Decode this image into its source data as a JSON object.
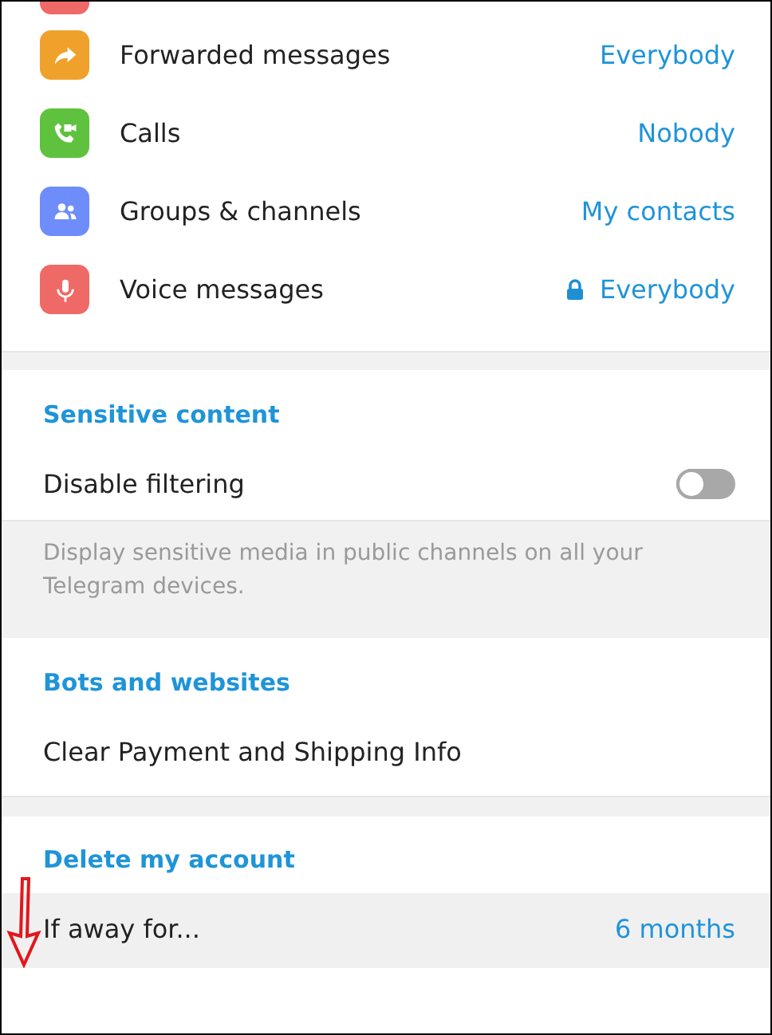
{
  "privacy_rows": [
    {
      "kind": "forward",
      "label": "Forwarded messages",
      "value": "Everybody",
      "locked": false,
      "color": "#f0a12b"
    },
    {
      "kind": "calls",
      "label": "Calls",
      "value": "Nobody",
      "locked": false,
      "color": "#5ec23e"
    },
    {
      "kind": "groups",
      "label": "Groups & channels",
      "value": "My contacts",
      "locked": false,
      "color": "#6e8dfb"
    },
    {
      "kind": "voice",
      "label": "Voice messages",
      "value": "Everybody",
      "locked": true,
      "color": "#ef6a66"
    }
  ],
  "sensitive_content": {
    "title": "Sensitive content",
    "toggle": {
      "label": "Disable filtering",
      "on": false
    },
    "description": "Display sensitive media in public channels on all your Telegram devices."
  },
  "bots_and_websites": {
    "title": "Bots and websites",
    "items": [
      {
        "label": "Clear Payment and Shipping Info"
      }
    ]
  },
  "delete_my_account": {
    "title": "Delete my account",
    "row": {
      "label": "If away for...",
      "value": "6 months",
      "selected": true
    }
  }
}
